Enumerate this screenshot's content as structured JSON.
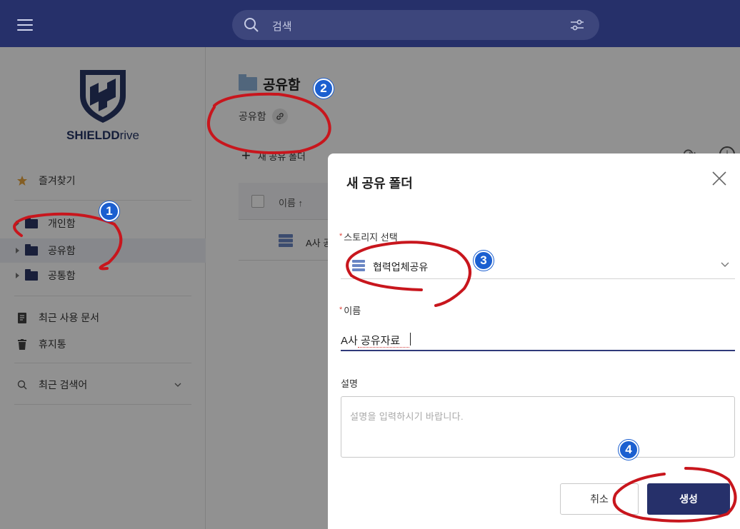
{
  "topbar": {
    "search_placeholder": "검색",
    "menu_icon": "hamburger-icon",
    "filter_icon": "sliders-icon"
  },
  "sidebar": {
    "logo_text_bold": "SHIELD",
    "logo_text_light": "rive",
    "logo_text_d": "D",
    "favorites": "즐겨찾기",
    "folders": [
      {
        "label": "개인함"
      },
      {
        "label": "공유함"
      },
      {
        "label": "공통함"
      }
    ],
    "recent_docs": "최근 사용 문서",
    "trash": "휴지통",
    "recent_search": "최근 검색어"
  },
  "main": {
    "title": "공유함",
    "breadcrumb": "공유함",
    "new_folder": "새 공유 폴더",
    "column_name": "이름",
    "sort_arrow": "↑",
    "rows": [
      {
        "name": "A사 공유자료"
      }
    ]
  },
  "modal": {
    "title": "새 공유 폴더",
    "storage_label": "스토리지 선택",
    "storage_value": "협력업체공유",
    "name_label": "이름",
    "name_value": "A사 공유자료",
    "desc_label": "설명",
    "desc_placeholder": "설명을 입력하시기 바랍니다.",
    "cancel": "취소",
    "create": "생성"
  },
  "annotations": {
    "badges": [
      "1",
      "2",
      "3",
      "4"
    ],
    "mark_color": "#c8161d",
    "badge_color": "#1b5fd0"
  },
  "colors": {
    "topbar": "#26306a",
    "primary_button": "#26306a",
    "required": "#e0443a"
  }
}
